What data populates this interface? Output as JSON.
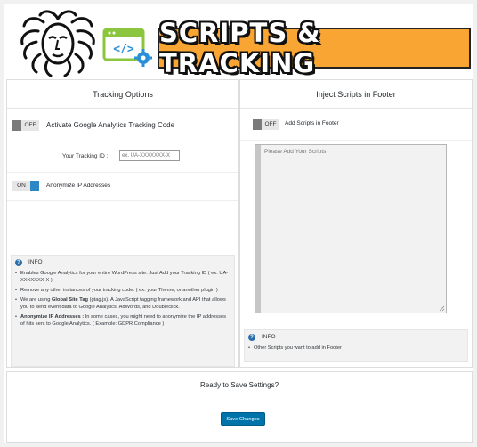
{
  "header": {
    "banner_text": "SCRIPTS & TRACKING",
    "logo_icon": "medusa-logo-icon",
    "code_icon": "code-settings-icon",
    "colors": {
      "banner": "#f9a533",
      "icon_green": "#8cc63f",
      "icon_blue": "#2b8fd8"
    }
  },
  "tracking": {
    "title": "Tracking Options",
    "ga_toggle": {
      "state": "OFF",
      "label": "Activate Google Analytics Tracking Code"
    },
    "tracking_id": {
      "label": "Your Tracking ID :",
      "placeholder": "ex. UA-XXXXXXX-X"
    },
    "anonymize_toggle": {
      "state": "ON",
      "label": "Anonymize IP Addresses"
    },
    "info": {
      "title": "INFO",
      "items": [
        {
          "text": "Enables Google Analytics for your entire WordPress site. Just Add your Tracking ID ( ex. UA-XXXXXXX-X )"
        },
        {
          "text": "Remove any other instances of your tracking code. ( ex. your Theme, or another plugin )"
        },
        {
          "pre": "We are using ",
          "bold": "Global Site Tag",
          "post": " (gtag.js). A JavaScript tagging framework and API that allows you to send event data to Google Analytics, AdWords, and Doubleclick."
        },
        {
          "pre": "",
          "bold": "Anonymize IP Addresses :",
          "post": " In some cases, you might need to anonymize the IP addresses of hits sent to Google Analytics. ( Example: GDPR Compliance )"
        }
      ]
    }
  },
  "footer_scripts": {
    "title": "Inject Scripts in Footer",
    "toggle": {
      "state": "OFF",
      "label": "Add Scripts in Footer"
    },
    "textarea_placeholder": "Please Add Your Scripts",
    "info": {
      "title": "INFO",
      "items": [
        {
          "text": "Other Scripts you want to add in Footer"
        }
      ]
    }
  },
  "save": {
    "title": "Ready to Save Settings?",
    "button_label": "Save Changes",
    "button_color": "#0073aa"
  }
}
